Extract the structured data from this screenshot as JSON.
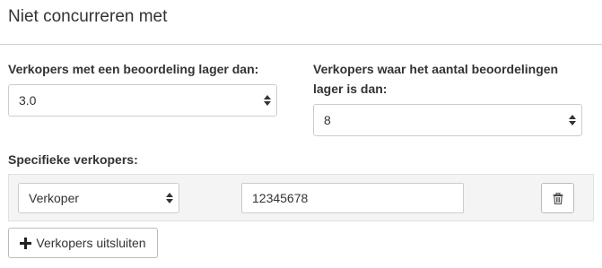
{
  "section": {
    "title": "Niet concurreren met"
  },
  "rating_filter": {
    "label": "Verkopers met een beoordeling lager dan:",
    "selected": "3.0"
  },
  "count_filter": {
    "label_line1": "Verkopers waar het aantal beoordelingen",
    "label_line2": "lager is dan:",
    "selected": "8"
  },
  "specific_sellers": {
    "label": "Specifieke verkopers:",
    "rows": [
      {
        "type_selected": "Verkoper",
        "value": "12345678"
      }
    ],
    "add_label": "Verkopers uitsluiten"
  },
  "icons": {
    "delete": "trash-icon",
    "add": "plus-icon",
    "select": "select-arrows-icon"
  }
}
